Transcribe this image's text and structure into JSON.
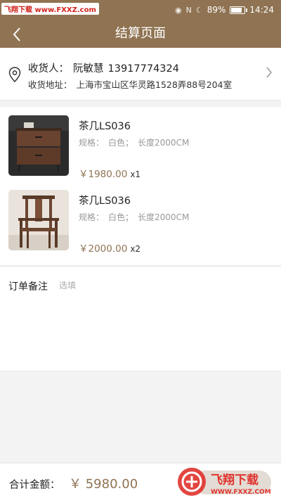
{
  "status_bar": {
    "watermark": "飞翔下载 www.FXXZ.com",
    "battery_text": "89%",
    "battery_level": 0.89,
    "time": "14:24"
  },
  "nav": {
    "title": "结算页面",
    "back_icon": "chevron-left-icon"
  },
  "address": {
    "icon": "location-pin-icon",
    "consignee_label": "收货人：",
    "consignee_name": "阮敏慧",
    "phone": "13917774324",
    "address_label": "收货地址：",
    "address_value": "上海市宝山区华灵路1528弄88号204室",
    "chevron_icon": "chevron-right-icon"
  },
  "products": [
    {
      "name": "茶几LS036",
      "spec_label": "规格：",
      "color": "白色；",
      "length": "长度2000CM",
      "price": "￥1980.00",
      "qty": "x1",
      "image": "nightstand-image"
    },
    {
      "name": "茶几LS036",
      "spec_label": "规格：",
      "color": "白色；",
      "length": "长度2000CM",
      "price": "￥2000.00",
      "qty": "x2",
      "image": "chair-image"
    }
  ],
  "remark": {
    "label": "订单备注",
    "placeholder": "选填"
  },
  "footer": {
    "total_label": "合计金额：",
    "total_amount": "￥ 5980.00"
  },
  "logo": {
    "brand": "飞翔下载",
    "url": "WWW.FXXZ.COM"
  },
  "colors": {
    "accent": "#8f7352",
    "watermark_red": "#d1231d",
    "logo_red": "#e0322c"
  }
}
